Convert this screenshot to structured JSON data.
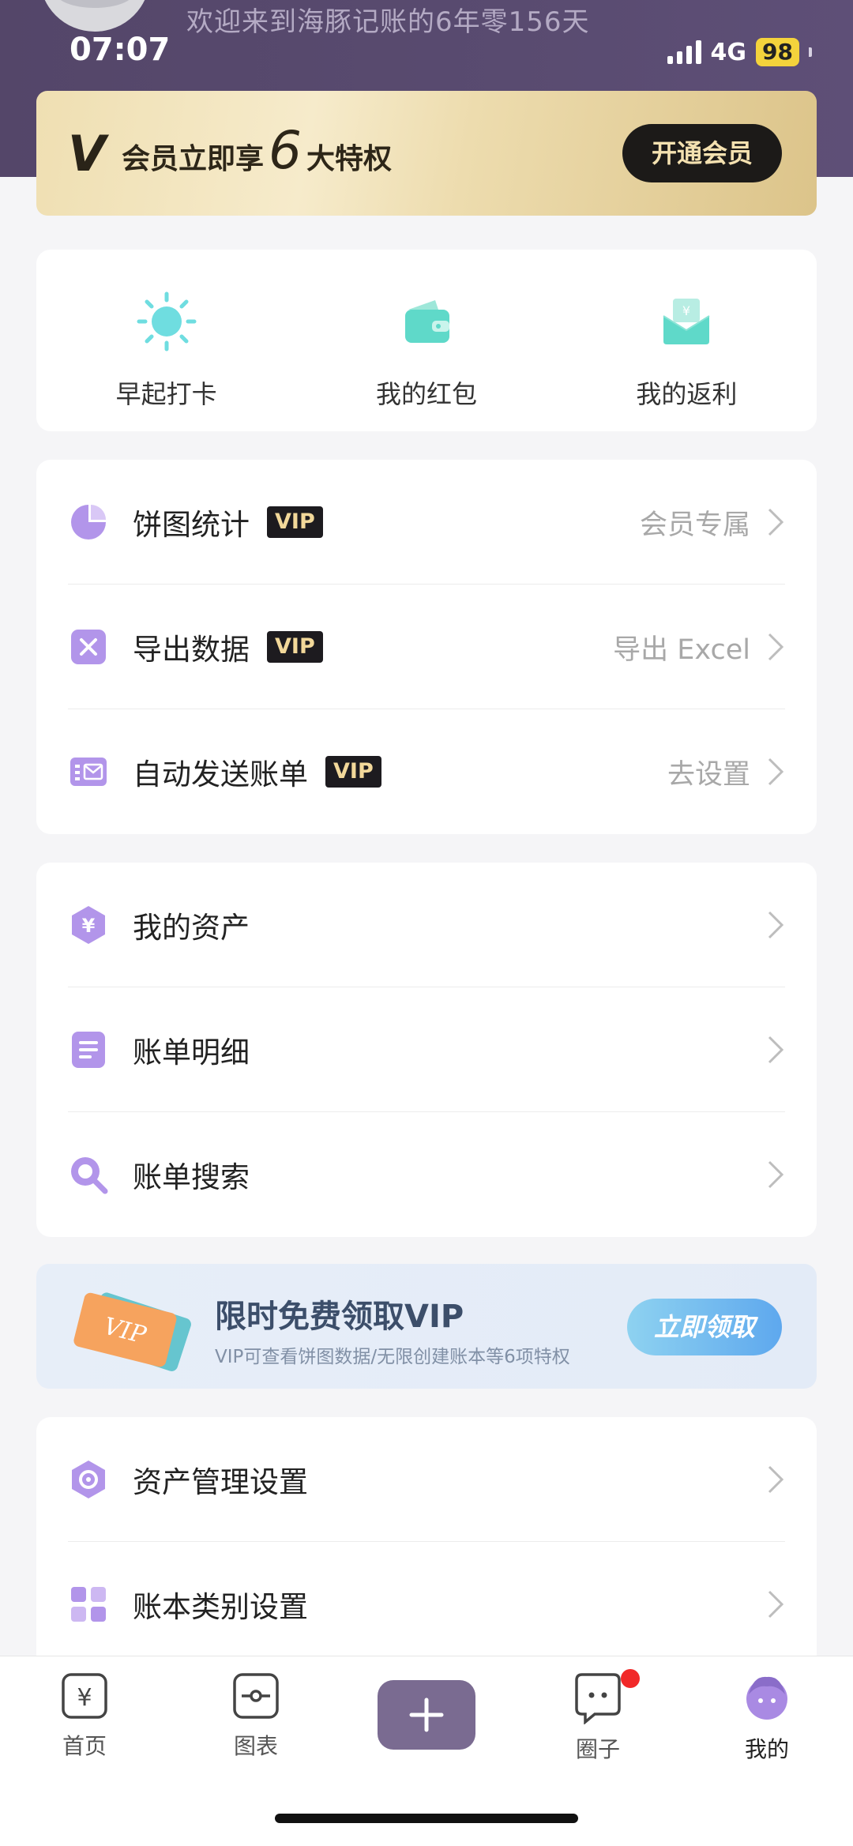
{
  "status": {
    "time": "07:07",
    "network": "4G",
    "battery": "98"
  },
  "header": {
    "welcome": "欢迎来到海豚记账的6年零156天"
  },
  "vip_banner": {
    "logo": "V",
    "text_prefix": "会员立即享",
    "number": "6",
    "text_suffix": "大特权",
    "button": "开通会员"
  },
  "quick_actions": [
    {
      "label": "早起打卡",
      "icon": "sun-icon"
    },
    {
      "label": "我的红包",
      "icon": "wallet-icon"
    },
    {
      "label": "我的返利",
      "icon": "envelope-icon"
    }
  ],
  "vip_section": [
    {
      "title": "饼图统计",
      "tag": "VIP",
      "hint": "会员专属",
      "icon": "pie-chart-icon"
    },
    {
      "title": "导出数据",
      "tag": "VIP",
      "hint": "导出 Excel",
      "icon": "export-icon"
    },
    {
      "title": "自动发送账单",
      "tag": "VIP",
      "hint": "去设置",
      "icon": "mail-icon"
    }
  ],
  "data_section": [
    {
      "title": "我的资产",
      "icon": "asset-icon"
    },
    {
      "title": "账单明细",
      "icon": "list-icon"
    },
    {
      "title": "账单搜索",
      "icon": "search-icon"
    }
  ],
  "promo": {
    "title": "限时免费领取VIP",
    "subtitle": "VIP可查看饼图数据/无限创建账本等6项特权",
    "button": "立即领取",
    "ticket_text": "VIP"
  },
  "settings_section": [
    {
      "title": "资产管理设置",
      "icon": "gear-icon"
    },
    {
      "title": "账本类别设置",
      "icon": "grid-icon"
    }
  ],
  "tabbar": [
    {
      "label": "首页",
      "icon": "yen-icon"
    },
    {
      "label": "图表",
      "icon": "chart-icon"
    },
    {
      "label": "圈子",
      "icon": "chat-icon"
    },
    {
      "label": "我的",
      "icon": "profile-icon"
    }
  ],
  "colors": {
    "header": "#544669",
    "accent_purple": "#a98ae3",
    "teal": "#5fd9c9",
    "vip_gold": "#f2d89a"
  }
}
